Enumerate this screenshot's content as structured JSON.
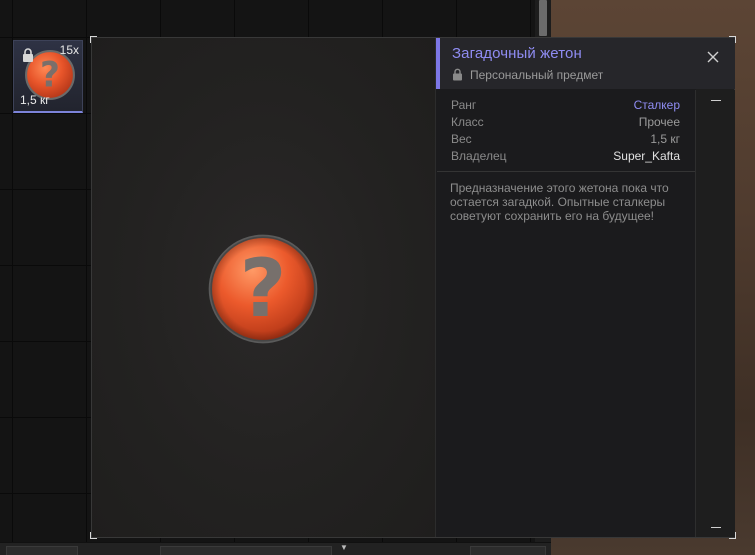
{
  "inventory": {
    "slot": {
      "count": "15x",
      "weight": "1,5 кг",
      "icon": "mystery-token-icon",
      "locked_icon": "lock-icon"
    }
  },
  "item": {
    "title": "Загадочный жетон",
    "subtitle": "Персональный предмет",
    "subtitle_icon": "lock-icon",
    "close_icon": "close-icon",
    "stats": [
      {
        "label": "Ранг",
        "value": "Сталкер"
      },
      {
        "label": "Класс",
        "value": "Прочее"
      },
      {
        "label": "Вес",
        "value": "1,5 кг"
      },
      {
        "label": "Владелец",
        "value": "Super_Kafta"
      }
    ],
    "description": "Предназначение этого жетона пока что остается загадкой. Опытные сталкеры советуют сохранить его на будущее!"
  },
  "colors": {
    "accent": "#7d77e6",
    "title": "#8f8cf2",
    "token_orange": "#e8552a"
  }
}
